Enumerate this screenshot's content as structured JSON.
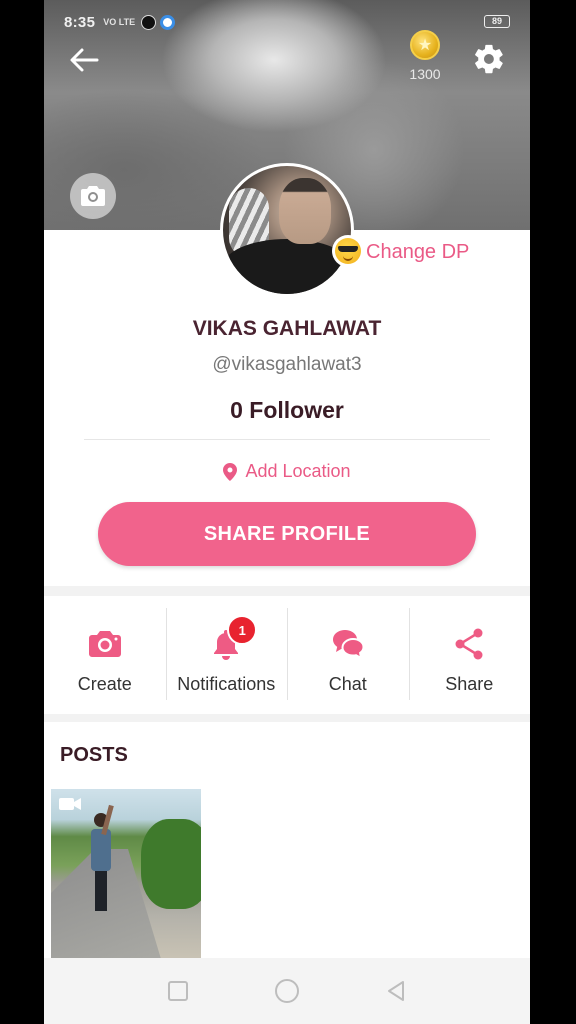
{
  "status_bar": {
    "time": "8:35",
    "network": "VO LTE",
    "battery": "89"
  },
  "header": {
    "coin_count": "1300",
    "icons": [
      "back-arrow-icon",
      "coin-icon",
      "gear-icon",
      "camera-icon"
    ]
  },
  "profile": {
    "change_dp_label": "Change DP",
    "name": "VIKAS GAHLAWAT",
    "handle": "@vikasgahlawat3",
    "followers": "0 Follower",
    "add_location_label": "Add Location",
    "share_profile_label": "SHARE PROFILE"
  },
  "actions": [
    {
      "label": "Create",
      "icon": "camera-icon"
    },
    {
      "label": "Notifications",
      "icon": "bell-icon",
      "badge": "1"
    },
    {
      "label": "Chat",
      "icon": "chat-bubbles-icon"
    },
    {
      "label": "Share",
      "icon": "share-icon"
    }
  ],
  "posts": {
    "title": "POSTS"
  },
  "colors": {
    "accent": "#f1638c",
    "accent_text": "#ea5a86",
    "badge": "#e8232f",
    "title_text": "#3a1c26"
  }
}
